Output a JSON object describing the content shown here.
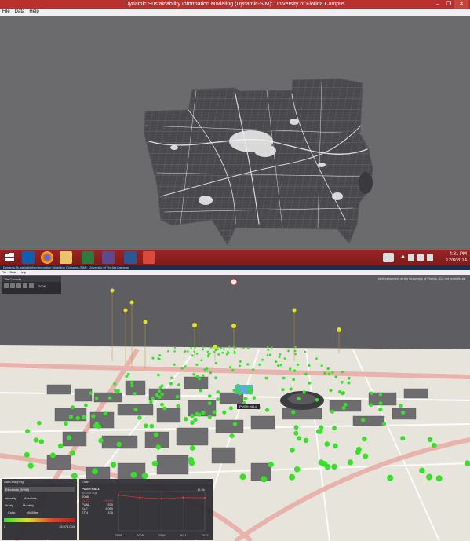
{
  "window1": {
    "title": "Dynamic Sustainability Information Modeling (Dynamic-SIM): University of Florida Campus",
    "menu": [
      "File",
      "Data",
      "Help"
    ],
    "controls": [
      "–",
      "❐",
      "✕"
    ]
  },
  "taskbar": {
    "time": "4:31 PM",
    "date": "12/8/2014",
    "apps": [
      "windows-start",
      "outlook",
      "chrome",
      "file-explorer",
      "app-green",
      "app-purple",
      "word",
      "app-paint"
    ]
  },
  "window2": {
    "title": "Dynamic Sustainability Information Modeling (Dynamic-SIM): University of Florida Campus",
    "menu": [
      "File",
      "Data",
      "Help"
    ],
    "top_right_note": "In development at the University of Florida - Do not redistribute",
    "playback_panel": {
      "title": "Tile Controls",
      "year": "2008"
    },
    "building_label": "PUGH HALL",
    "data_mapping": {
      "title": "Data Mapping",
      "select_value": "Electricity (KWH)",
      "opt1": "Intensity",
      "opt2": "Absolute",
      "opt3": "Yearly",
      "opt4": "Monthly",
      "color_label": "Color",
      "minmax_label": "Min/Max",
      "scale_min": "0",
      "scale_max": "15,673,000"
    },
    "chart_panel": {
      "title": "Chart",
      "building": "PUGH HALL",
      "subtitle": "40,000 sqft",
      "rows": [
        {
          "label": "2008",
          "value": ""
        },
        {
          "label": "ELEC",
          "value": "14,000"
        },
        {
          "label": "FUAL",
          "value": "370"
        },
        {
          "label": "KLE",
          "value": "1,050"
        },
        {
          "label": "ETN",
          "value": "130"
        }
      ],
      "ymax_label": "14.0k"
    }
  },
  "chart_data": {
    "type": "line",
    "title": "",
    "x": [
      "2008",
      "2009",
      "2010",
      "2011",
      "2012"
    ],
    "series": [
      {
        "values": [
          1.0,
          0.93,
          0.9,
          0.93,
          0.92
        ]
      }
    ],
    "xlabel": "",
    "ylabel": "",
    "ylim": [
      0,
      1.1
    ]
  }
}
